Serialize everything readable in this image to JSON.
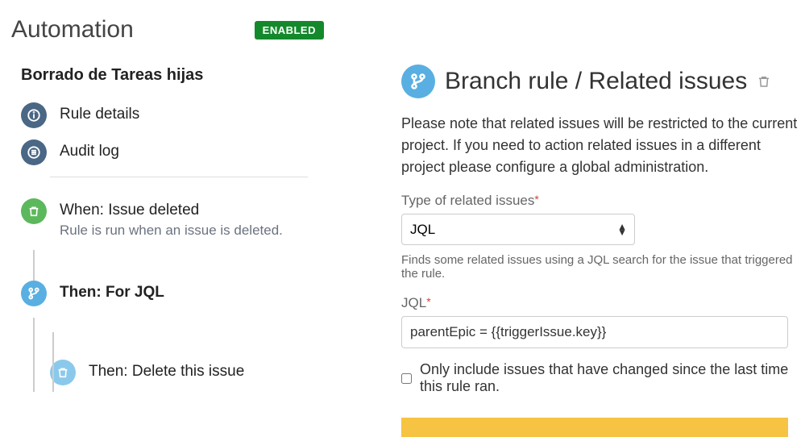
{
  "header": {
    "title": "Automation",
    "status_badge": "ENABLED"
  },
  "rule": {
    "name": "Borrado de Tareas hijas"
  },
  "nav": {
    "rule_details": "Rule details",
    "audit_log": "Audit log"
  },
  "steps": {
    "trigger": {
      "title": "When: Issue deleted",
      "desc": "Rule is run when an issue is deleted."
    },
    "branch": {
      "title": "Then: For JQL"
    },
    "action": {
      "title": "Then: Delete this issue"
    }
  },
  "panel": {
    "title": "Branch rule / Related issues",
    "note": "Please note that related issues will be restricted to the current project. If you need to action related issues in a different project please configure a global administration.",
    "type_label": "Type of related issues",
    "type_value": "JQL",
    "type_hint": "Finds some related issues using a JQL search for the issue that triggered the rule.",
    "jql_label": "JQL",
    "jql_value": "parentEpic = {{triggerIssue.key}}",
    "only_changed": "Only include issues that have changed since the last time this rule ran."
  },
  "icons": {
    "info": "info-icon",
    "list": "list-icon",
    "trash": "trash-icon",
    "branch": "branch-icon"
  }
}
